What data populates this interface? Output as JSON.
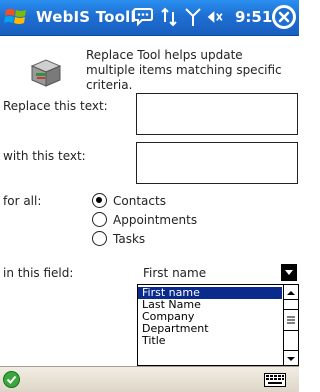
{
  "titlebar": {
    "title": "WebIS Tooll",
    "time": "9:51",
    "icons": [
      "windows-logo-icon",
      "chat-icon",
      "connectivity-icon",
      "signal-icon",
      "volume-icon",
      "close-icon"
    ]
  },
  "header": {
    "description": "Replace Tool helps update multiple items matching specific criteria.",
    "icon": "toolbox-icon"
  },
  "form": {
    "replace_label": "Replace this text:",
    "replace_value": "",
    "with_label": "with this text:",
    "with_value": "",
    "for_all_label": "for all:",
    "options": [
      "Contacts",
      "Appointments",
      "Tasks"
    ],
    "selected_option": "Contacts",
    "field_label": "in this field:",
    "field_value": "First name",
    "field_options": [
      "First name",
      "Last Name",
      "Company",
      "Department",
      "Title"
    ]
  },
  "bottombar": {
    "icons": [
      "ok-icon",
      "keyboard-icon"
    ]
  },
  "colors": {
    "titlebar": "#1e6fd2",
    "selection": "#0a2a8c",
    "ok_green": "#3aa83a"
  }
}
